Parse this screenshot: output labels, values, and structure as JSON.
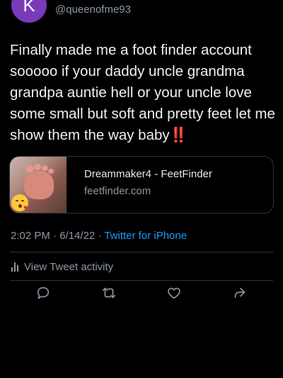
{
  "author": {
    "avatar_letter": "K",
    "handle": "@queenofme93"
  },
  "tweet": {
    "text": "Finally made me a foot finder account sooooo if your daddy uncle grandma grandpa auntie hell or your uncle love some small but soft and pretty feet let me show them the way baby",
    "emoji_suffix": "‼️"
  },
  "card": {
    "title": "Dreammaker4 - FeetFinder",
    "domain": "feetfinder.com",
    "thumbnail_overlay_emoji": "face-blowing-kiss"
  },
  "meta": {
    "time": "2:02 PM",
    "separator": "·",
    "date": "6/14/22",
    "source": "Twitter for iPhone"
  },
  "activity": {
    "label": "View Tweet activity"
  },
  "actions": [
    "reply-icon",
    "retweet-icon",
    "like-icon",
    "share-icon"
  ],
  "colors": {
    "background": "#000000",
    "text": "#e7e9ea",
    "secondary_text": "#8b98a5",
    "link": "#1d9bf0",
    "avatar": "#7b3ab8",
    "border": "#2f3336"
  }
}
